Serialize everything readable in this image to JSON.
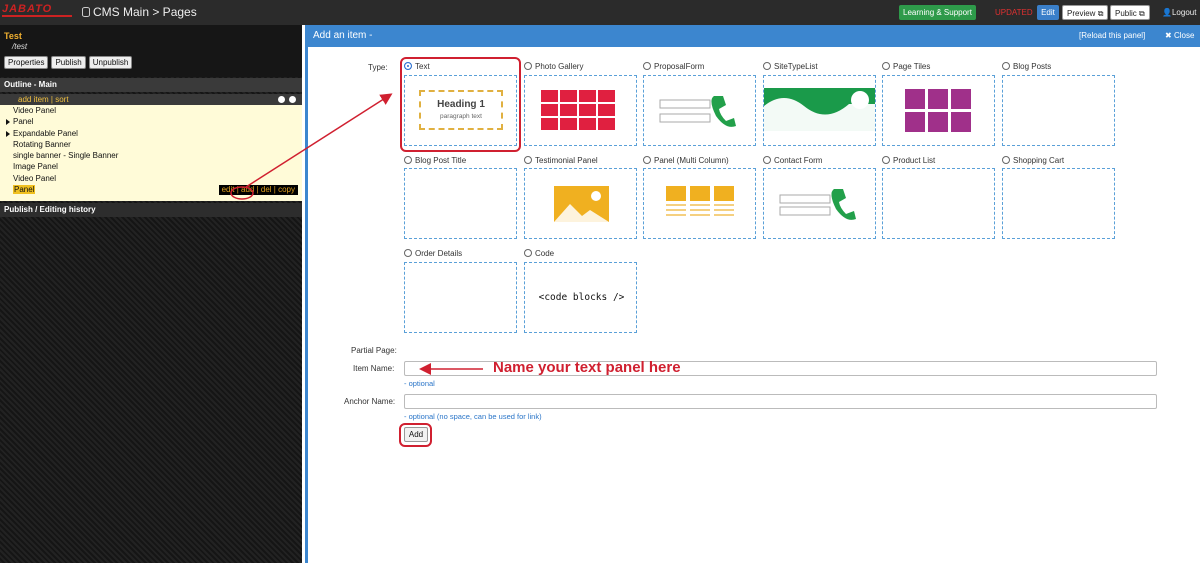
{
  "topbar": {
    "logo": "JABATO",
    "breadcrumb": "CMS Main  > Pages",
    "learning": "Learning & Support",
    "status": "UPDATED",
    "edit": "Edit",
    "preview": "Preview",
    "public": "Public",
    "logout": "Logout"
  },
  "sidebar": {
    "title": "Test",
    "path": "/test",
    "buttons": [
      "Properties",
      "Publish",
      "Unpublish"
    ],
    "outline_header": "Outline - Main",
    "add_sort": "add item | sort",
    "items": [
      "Video Panel",
      "Panel",
      "Expandable Panel",
      "Rotating Banner",
      "single banner - Single Banner",
      "Image Panel",
      "Video Panel",
      "Panel"
    ],
    "actions": "edit | add | del | copy",
    "history_header": "Publish / Editing history"
  },
  "panel": {
    "title": "Add an item -",
    "reload": "[Reload this panel]",
    "close": "Close",
    "type_label": "Type:",
    "types": [
      {
        "label": "Text",
        "selected": true
      },
      {
        "label": "Photo Gallery"
      },
      {
        "label": "ProposalForm"
      },
      {
        "label": "SiteTypeList"
      },
      {
        "label": "Page Tiles"
      },
      {
        "label": "Blog Posts"
      },
      {
        "label": "Blog Post Title"
      },
      {
        "label": "Testimonial Panel"
      },
      {
        "label": "Panel (Multi Column)"
      },
      {
        "label": "Contact Form"
      },
      {
        "label": "Product List"
      },
      {
        "label": "Shopping Cart"
      },
      {
        "label": "Order Details"
      },
      {
        "label": "Code"
      }
    ],
    "text_preview": {
      "heading": "Heading 1",
      "sub": "paragraph text"
    },
    "code_preview": "<code blocks />",
    "partial_label": "Partial Page:",
    "item_name_label": "Item Name:",
    "item_hint": "- optional",
    "anchor_label": "Anchor Name:",
    "anchor_hint": "- optional (no space, can be used for link)",
    "add_button": "Add",
    "annotation": "Name your text panel here"
  },
  "colors": {
    "accent": "#3c86cf",
    "annotation": "#d02030",
    "gallery": "#e02040",
    "tiles": "#a0308a",
    "images": "#f0b020",
    "phone": "#22a04a",
    "banner": "#1a9a4a"
  }
}
